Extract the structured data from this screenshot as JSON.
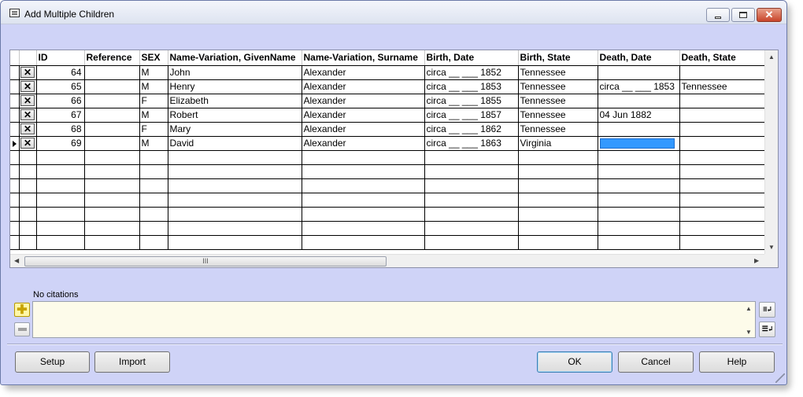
{
  "window": {
    "title": "Add Multiple Children"
  },
  "grid": {
    "columns": [
      "ID",
      "Reference",
      "SEX",
      "Name-Variation, GivenName",
      "Name-Variation, Surname",
      "Birth, Date",
      "Birth, State",
      "Death, Date",
      "Death, State"
    ],
    "rows": [
      {
        "id": "64",
        "reference": "",
        "sex": "M",
        "given": "John",
        "surname": "Alexander",
        "birth_date": "circa __ ___ 1852",
        "birth_state": "Tennessee",
        "death_date": "",
        "death_state": ""
      },
      {
        "id": "65",
        "reference": "",
        "sex": "M",
        "given": "Henry",
        "surname": "Alexander",
        "birth_date": "circa __ ___ 1853",
        "birth_state": "Tennessee",
        "death_date": "circa __ ___ 1853",
        "death_state": "Tennessee"
      },
      {
        "id": "66",
        "reference": "",
        "sex": "F",
        "given": "Elizabeth",
        "surname": "Alexander",
        "birth_date": "circa __ ___ 1855",
        "birth_state": "Tennessee",
        "death_date": "",
        "death_state": ""
      },
      {
        "id": "67",
        "reference": "",
        "sex": "M",
        "given": "Robert",
        "surname": "Alexander",
        "birth_date": "circa __ ___ 1857",
        "birth_state": "Tennessee",
        "death_date": "04 Jun 1882",
        "death_state": ""
      },
      {
        "id": "68",
        "reference": "",
        "sex": "F",
        "given": "Mary",
        "surname": "Alexander",
        "birth_date": "circa __ ___ 1862",
        "birth_state": "Tennessee",
        "death_date": "",
        "death_state": ""
      },
      {
        "id": "69",
        "reference": "",
        "sex": "M",
        "given": "David",
        "surname": "Alexander",
        "birth_date": "circa __ ___ 1863",
        "birth_state": "Virginia",
        "death_date": "",
        "death_state": ""
      }
    ],
    "hscroll_grip": "III"
  },
  "citations": {
    "label": "No citations"
  },
  "buttons": {
    "setup": "Setup",
    "import": "Import",
    "ok": "OK",
    "cancel": "Cancel",
    "help": "Help"
  },
  "colors": {
    "window_bg": "#cfd3f7",
    "editing_cell": "#3399ff",
    "citation_bg": "#fdfbea"
  }
}
